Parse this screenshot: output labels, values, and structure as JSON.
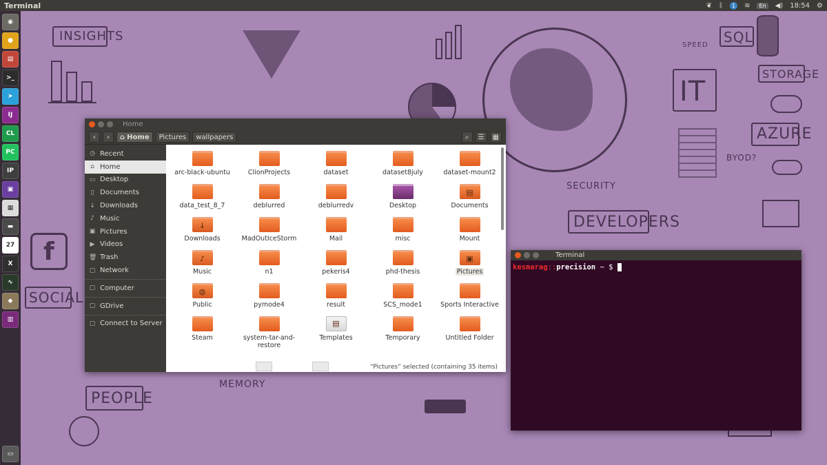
{
  "top_panel": {
    "app_title": "Terminal",
    "keyboard": "En",
    "notification_count": "1",
    "time": "18:54"
  },
  "launcher": {
    "items": [
      {
        "name": "dash-icon",
        "glyph": "◉",
        "color": "#6b6a65"
      },
      {
        "name": "chrome-icon",
        "glyph": "●",
        "color": "#e0a31a"
      },
      {
        "name": "files-icon",
        "glyph": "▤",
        "color": "#c1473a"
      },
      {
        "name": "terminal-icon",
        "glyph": ">_",
        "color": "#2c2c2c"
      },
      {
        "name": "telegram-icon",
        "glyph": "➤",
        "color": "#2aa1da"
      },
      {
        "name": "intellij-icon",
        "glyph": "IJ",
        "color": "#8b2b8f"
      },
      {
        "name": "clion-icon",
        "glyph": "CL",
        "color": "#1f9b4c"
      },
      {
        "name": "pycharm-icon",
        "glyph": "PC",
        "color": "#21c25e"
      },
      {
        "name": "ipython-icon",
        "glyph": "IP",
        "color": "#3f3f3f"
      },
      {
        "name": "image-viewer-icon",
        "glyph": "▣",
        "color": "#6a3fa0"
      },
      {
        "name": "document-icon",
        "glyph": "▦",
        "color": "#dcdcdc"
      },
      {
        "name": "storage-icon",
        "glyph": "▬",
        "color": "#4a4a4a"
      },
      {
        "name": "calendar-icon",
        "glyph": "27",
        "color": "#ffffff"
      },
      {
        "name": "x-app-icon",
        "glyph": "X",
        "color": "#2f2f2f"
      },
      {
        "name": "system-monitor-icon",
        "glyph": "∿",
        "color": "#2a3a2a"
      },
      {
        "name": "gimp-icon",
        "glyph": "◆",
        "color": "#8a7a5a"
      },
      {
        "name": "workspace-switcher-icon",
        "glyph": "▥",
        "color": "#7a2a7a"
      }
    ]
  },
  "file_manager": {
    "window_title": "Home",
    "breadcrumbs": [
      "Home",
      "Pictures",
      "wallpapers"
    ],
    "sidebar": [
      {
        "label": "Recent",
        "icon": "◷",
        "icon_name": "recent-icon"
      },
      {
        "label": "Home",
        "icon": "⌂",
        "icon_name": "home-icon",
        "active": true
      },
      {
        "label": "Desktop",
        "icon": "▭",
        "icon_name": "desktop-icon"
      },
      {
        "label": "Documents",
        "icon": "▯",
        "icon_name": "documents-icon"
      },
      {
        "label": "Downloads",
        "icon": "↓",
        "icon_name": "downloads-icon"
      },
      {
        "label": "Music",
        "icon": "♪",
        "icon_name": "music-icon"
      },
      {
        "label": "Pictures",
        "icon": "▣",
        "icon_name": "pictures-icon"
      },
      {
        "label": "Videos",
        "icon": "▶",
        "icon_name": "videos-icon"
      },
      {
        "label": "Trash",
        "icon": "🗑",
        "icon_name": "trash-icon"
      },
      {
        "label": "Network",
        "icon": "▢",
        "icon_name": "network-icon"
      },
      {
        "label": "Computer",
        "icon": "▢",
        "icon_name": "computer-icon",
        "sep_before": true
      },
      {
        "label": "GDrive",
        "icon": "▢",
        "icon_name": "drive-icon",
        "sep_before": true
      },
      {
        "label": "Connect to Server",
        "icon": "▢",
        "icon_name": "server-icon",
        "sep_before": true
      }
    ],
    "items": [
      {
        "label": "arc-black-ubuntu",
        "kind": "folder"
      },
      {
        "label": "ClionProjects",
        "kind": "folder"
      },
      {
        "label": "dataset",
        "kind": "folder"
      },
      {
        "label": "dataset8july",
        "kind": "folder"
      },
      {
        "label": "dataset-mount2",
        "kind": "folder"
      },
      {
        "label": "data_test_8_7",
        "kind": "folder"
      },
      {
        "label": "deblurred",
        "kind": "folder"
      },
      {
        "label": "deblurredv",
        "kind": "folder"
      },
      {
        "label": "Desktop",
        "kind": "desktop"
      },
      {
        "label": "Documents",
        "kind": "documents"
      },
      {
        "label": "Downloads",
        "kind": "downloads"
      },
      {
        "label": "MadOutIceStorm",
        "kind": "folder"
      },
      {
        "label": "Mail",
        "kind": "folder"
      },
      {
        "label": "misc",
        "kind": "folder"
      },
      {
        "label": "Mount",
        "kind": "folder"
      },
      {
        "label": "Music",
        "kind": "music"
      },
      {
        "label": "n1",
        "kind": "folder"
      },
      {
        "label": "pekeris4",
        "kind": "folder"
      },
      {
        "label": "phd-thesis",
        "kind": "folder"
      },
      {
        "label": "Pictures",
        "kind": "pictures",
        "selected": true
      },
      {
        "label": "Public",
        "kind": "public"
      },
      {
        "label": "pymode4",
        "kind": "folder"
      },
      {
        "label": "result",
        "kind": "folder"
      },
      {
        "label": "SCS_mode1",
        "kind": "folder"
      },
      {
        "label": "Sports Interactive",
        "kind": "folder"
      },
      {
        "label": "Steam",
        "kind": "folder"
      },
      {
        "label": "system-tar-and-restore",
        "kind": "folder"
      },
      {
        "label": "Templates",
        "kind": "templates"
      },
      {
        "label": "Temporary",
        "kind": "folder"
      },
      {
        "label": "Untitled Folder",
        "kind": "folder"
      }
    ],
    "status": "“Pictures” selected  (containing 35 items)"
  },
  "terminal": {
    "window_title": "Terminal",
    "user": "kesmarag",
    "separator": "::",
    "host": "precision",
    "path": "~",
    "symbol": "$"
  },
  "wallpaper": {
    "labels": [
      "INSIGHTS",
      "SQL",
      "STORAGE",
      "AZURE",
      "BYOD?",
      "SECURITY",
      "DEVELOPERS",
      "SOCIAL",
      "PEOPLE",
      "MEMORY",
      "IT",
      "SPEED"
    ],
    "accent": "#a887b5"
  }
}
